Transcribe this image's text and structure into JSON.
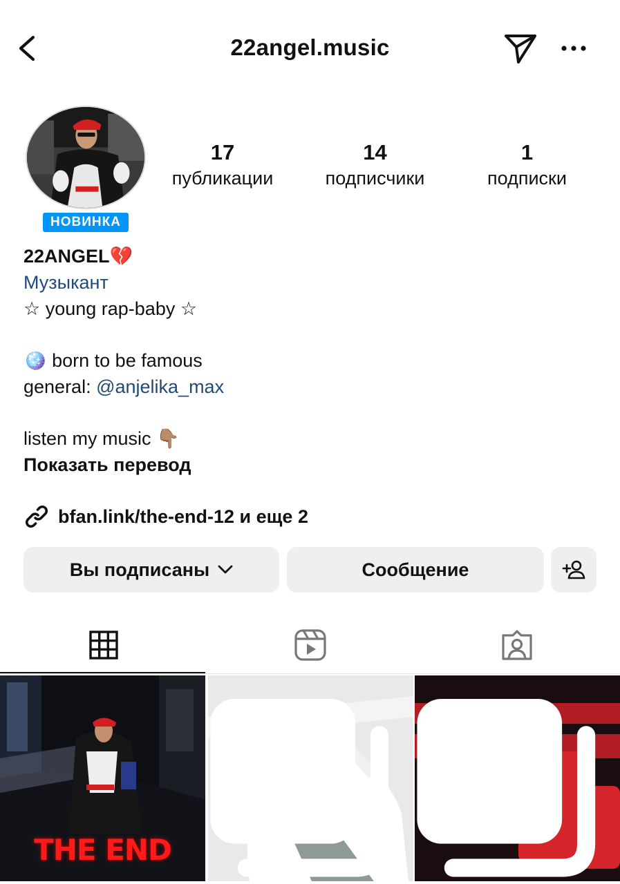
{
  "header": {
    "title": "22angel.music"
  },
  "profile": {
    "badge": "НОВИНКА",
    "stats": [
      {
        "num": "17",
        "label": "публикации"
      },
      {
        "num": "14",
        "label": "подписчики"
      },
      {
        "num": "1",
        "label": "подписки"
      }
    ],
    "name": "22ANGEL💔",
    "category": "Музыкант",
    "bio_line1": "☆ young rap-baby ☆",
    "bio_line2": "🪩 born to be famous",
    "bio_general_prefix": "general: ",
    "bio_mention": "@anjelika_max",
    "bio_line4": "listen my music 👇🏽",
    "translate": "Показать перевод",
    "link": "bfan.link/the-end-12 и еще 2"
  },
  "actions": {
    "follow_label": "Вы подписаны",
    "message_label": "Сообщение"
  },
  "tabs": [
    "grid-icon",
    "reels-icon",
    "tagged-icon"
  ],
  "posts": [
    {
      "caption": "THE END",
      "multi": false
    },
    {
      "caption": "",
      "multi": true
    },
    {
      "caption": "",
      "multi": true
    }
  ],
  "colors": {
    "badge": "#0095f6",
    "link_blue": "#1f4a7a",
    "button_bg": "#efefef"
  }
}
